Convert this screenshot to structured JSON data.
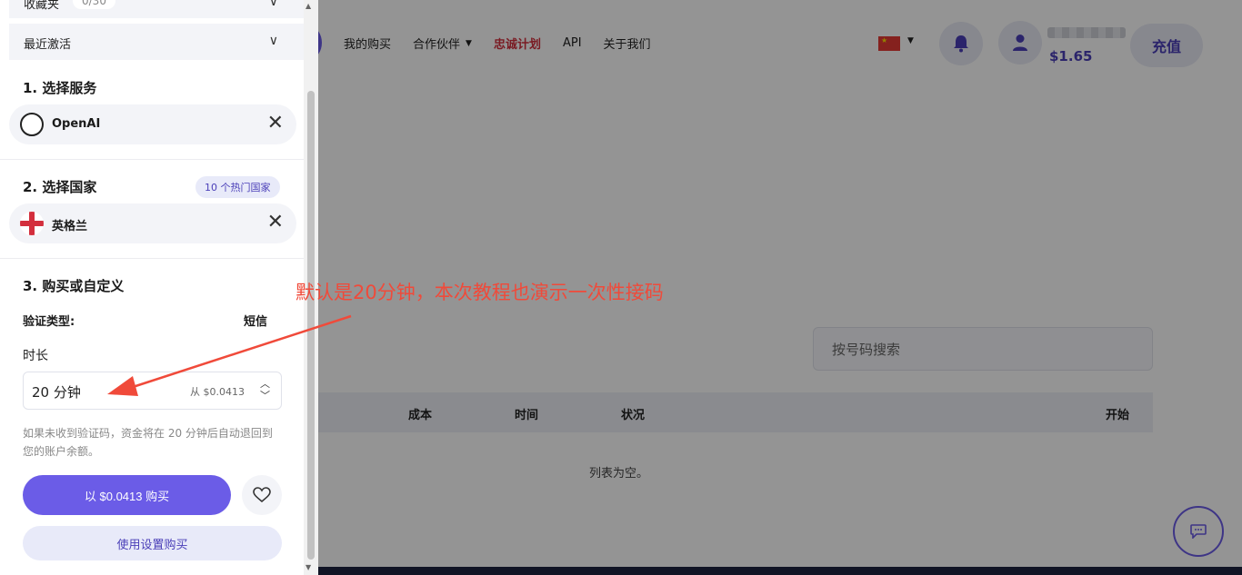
{
  "header": {
    "nav": [
      {
        "label": "我的购买"
      },
      {
        "label": "合作伙伴"
      },
      {
        "label": "忠诚计划"
      },
      {
        "label": "API"
      },
      {
        "label": "关于我们"
      }
    ],
    "balance": "$1.65",
    "topup_label": "充值"
  },
  "main": {
    "search_placeholder": "按号码搜索",
    "table": {
      "columns": [
        "成本",
        "时间",
        "状况",
        "开始"
      ],
      "empty": "列表为空。"
    }
  },
  "drawer": {
    "favorites_count": "0/30",
    "recent_label": "最近激活",
    "step1_title": "1. 选择服务",
    "service": "OpenAI",
    "step2_title": "2. 选择国家",
    "hot_countries": "10 个热门国家",
    "country": "英格兰",
    "step3_title": "3. 购买或自定义",
    "verify_type_label": "验证类型:",
    "verify_type_value": "短信",
    "duration_label": "时长",
    "duration_value": "20 分钟",
    "duration_price": "从 $0.0413",
    "note": "如果未收到验证码，资金将在 20 分钟后自动退回到您的账户余额。",
    "buy_label": "以 $0.0413 购买",
    "settings_buy_label": "使用设置购买"
  },
  "annotation": {
    "text": "默认是20分钟，本次教程也演示一次性接码",
    "color": "#f04a3a"
  },
  "colors": {
    "accent": "#6b5ce7",
    "highlight": "#d32f3d"
  }
}
